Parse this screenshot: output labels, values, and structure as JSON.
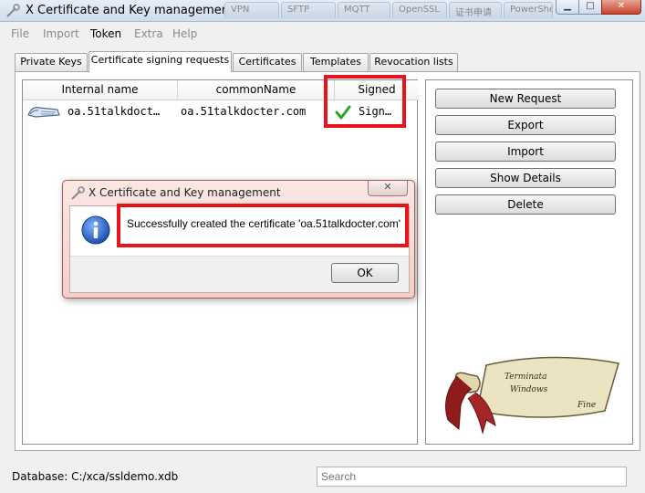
{
  "window": {
    "title": "X Certificate and Key management",
    "background_tabs": [
      "VPN",
      "SFTP",
      "MQTT",
      "OpenSSL",
      "证书申请",
      "PowerShell"
    ]
  },
  "menu": [
    {
      "label": "File",
      "enabled": false
    },
    {
      "label": "Import",
      "enabled": false
    },
    {
      "label": "Token",
      "enabled": true
    },
    {
      "label": "Extra",
      "enabled": false
    },
    {
      "label": "Help",
      "enabled": false
    }
  ],
  "tabs": [
    {
      "label": "Private Keys",
      "active": false
    },
    {
      "label": "Certificate signing requests",
      "active": true
    },
    {
      "label": "Certificates",
      "active": false
    },
    {
      "label": "Templates",
      "active": false
    },
    {
      "label": "Revocation lists",
      "active": false
    }
  ],
  "table": {
    "columns": [
      "Internal name",
      "commonName",
      "Signed"
    ],
    "rows": [
      {
        "internal_name": "oa.51talkdoct…",
        "common_name": "oa.51talkdocter.com",
        "signed": "Sign…",
        "signed_icon": "checkmark-icon"
      }
    ]
  },
  "side_buttons": [
    "New Request",
    "Export",
    "Import",
    "Show Details",
    "Delete"
  ],
  "status": {
    "database": "Database: C:/xca/ssldemo.xdb",
    "search_placeholder": "Search"
  },
  "dialog": {
    "title": "X Certificate and Key management",
    "message": "Successfully created the certificate 'oa.51talkdocter.com'",
    "ok_label": "OK",
    "icon": "info-icon"
  },
  "logo": {
    "scroll_text_line1": "Terminata",
    "scroll_text_line2": "Windows",
    "scroll_text_line3": "Fine"
  },
  "colors": {
    "highlight": "#e8141c",
    "check": "#2aa52a",
    "info_icon": "#1f5fbf"
  }
}
